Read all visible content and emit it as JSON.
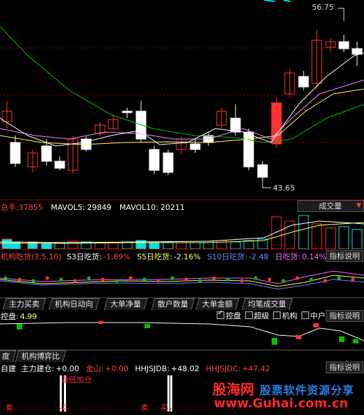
{
  "colors": {
    "up": "#ff3232",
    "down": "#00e0e0",
    "grid": "#8a0000",
    "white": "#ffffff",
    "yellow": "#ffff00",
    "magenta": "#ff66ff",
    "green": "#00c000"
  },
  "price_panel": {
    "high_label": "56.75",
    "low_label": "43.65"
  },
  "volume_panel": {
    "prefix": "总手:",
    "total": "37855",
    "mavol5_label": "MAVOL5:",
    "mavol5": "29849",
    "mavol10_label": "MAVOL10:",
    "mavol10": "20211",
    "selector": "成交量"
  },
  "inst_panel": {
    "title": "机构吃货(3,5,10)",
    "s3_label": "S3日吃货:",
    "s3": "-1.89%",
    "s5_label": "S5日吃货:",
    "s5": "-2.16%",
    "s10_label": "S10日吃货:",
    "s10": "-2.48",
    "ri_label": "日吃货:",
    "ri": "0.14%",
    "help": "指标说明"
  },
  "tabs": [
    "主力买卖",
    "机构日动向",
    "大单净量",
    "散户数量",
    "大单金额",
    "均笔成交量"
  ],
  "control_panel": {
    "label": "控盘:",
    "value": "4.99",
    "checks": [
      {
        "label": "控盘",
        "checked": true
      },
      {
        "label": "超级",
        "checked": false
      },
      {
        "label": "机构",
        "checked": false
      },
      {
        "label": "中户",
        "checked": false
      }
    ],
    "help": "指标说明"
  },
  "bottom_tabs": [
    "度",
    "机构博弈比"
  ],
  "bottom_panel": {
    "prefix": "自建",
    "zl_label": "主力建仓:",
    "zl": "+0.00",
    "js_label": "金山:",
    "js": "+0.00",
    "db_label": "HHJSJDB:",
    "db": "+48.02",
    "dc_label": "HHJSJDC:",
    "dc": "+47.42",
    "note": "逢低加仓",
    "help": "指标说明",
    "markers": [
      "卖",
      "买",
      "卖",
      "买"
    ]
  },
  "watermark": {
    "brand": "股海网",
    "slogan": "股票软件资源分享",
    "url": "www.Guhai.com.cn"
  }
}
